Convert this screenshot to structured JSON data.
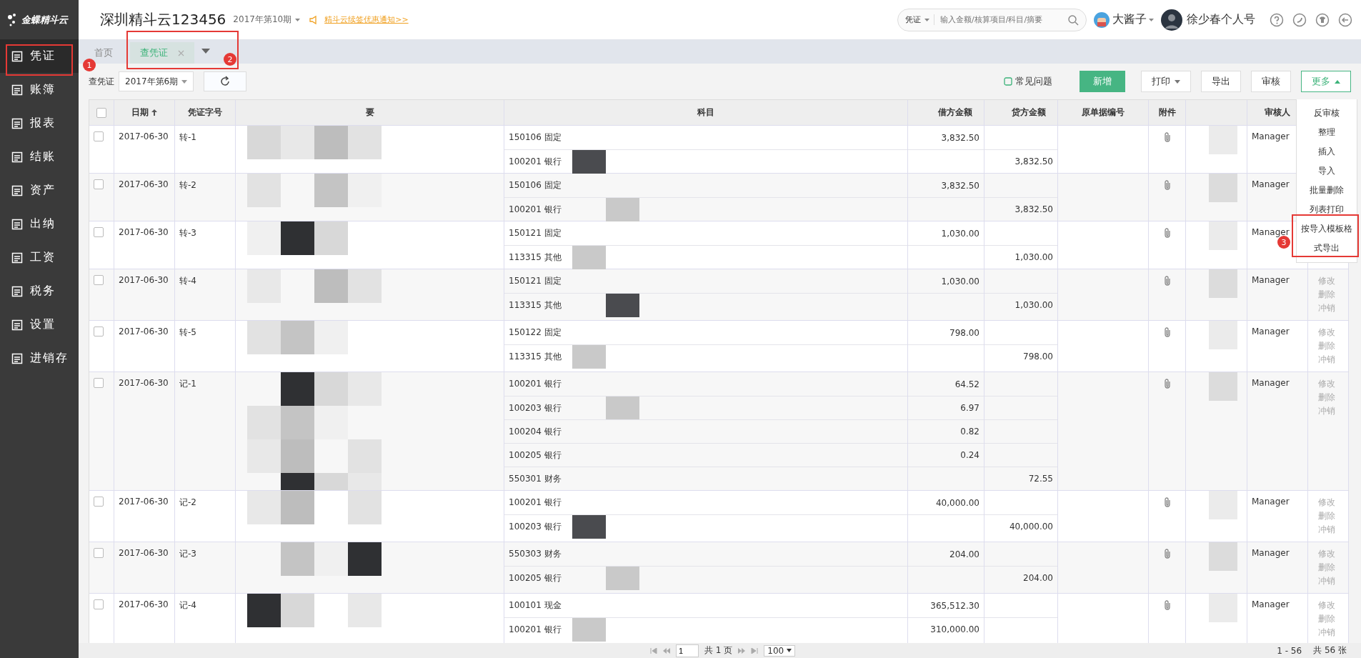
{
  "logo": {
    "text": "金蝶精斗云"
  },
  "sidebar": {
    "items": [
      {
        "label": "凭证",
        "selected": true
      },
      {
        "label": "账簿",
        "selected": false
      },
      {
        "label": "报表",
        "selected": false
      },
      {
        "label": "结账",
        "selected": false
      },
      {
        "label": "资产",
        "selected": false
      },
      {
        "label": "出纳",
        "selected": false
      },
      {
        "label": "工资",
        "selected": false
      },
      {
        "label": "税务",
        "selected": false
      },
      {
        "label": "设置",
        "selected": false
      },
      {
        "label": "进销存",
        "selected": false
      }
    ]
  },
  "header": {
    "company": "深圳精斗云123456",
    "period": "2017年第10期",
    "notice": "精斗云续签优惠通知>>",
    "search_scope": "凭证",
    "search": {
      "placeholder": "输入金额/核算项目/科目/摘要"
    },
    "account": "大酱子",
    "user": "徐少春个人号"
  },
  "tabs": [
    {
      "label": "首页",
      "selected": false,
      "closable": false
    },
    {
      "label": "查凭证",
      "selected": true,
      "closable": true
    }
  ],
  "toolbar": {
    "label": "查凭证",
    "period": "2017年第6期",
    "help": "常见问题",
    "buttons": [
      {
        "label": "新增",
        "kind": "primary"
      },
      {
        "label": "打印",
        "kind": "dropdown"
      },
      {
        "label": "导出",
        "kind": "plain"
      },
      {
        "label": "审核",
        "kind": "plain"
      },
      {
        "label": "更多",
        "kind": "open"
      }
    ]
  },
  "more_menu": [
    "反审核",
    "整理",
    "插入",
    "导入",
    "批量删除",
    "列表打印",
    "按导入模板格",
    "式导出"
  ],
  "table": {
    "select_all": {
      "checked": false
    },
    "columns": [
      "日期",
      "凭证字号",
      "要",
      "科目",
      "借方金额",
      "贷方金额",
      "原单据编号",
      "附件",
      "审核人"
    ],
    "rows": [
      {
        "checked": false,
        "date": "2017-06-30",
        "number": "转-1",
        "attachment": true,
        "reviewer": "Manager",
        "lines": [
          {
            "account": "150106 固定",
            "debit": "3,832.50"
          },
          {
            "account": "100201 银行",
            "credit": "3,832.50"
          }
        ]
      },
      {
        "checked": false,
        "date": "2017-06-30",
        "number": "转-2",
        "attachment": true,
        "reviewer": "Manager",
        "lines": [
          {
            "account": "150106 固定",
            "debit": "3,832.50"
          },
          {
            "account": "100201 银行",
            "credit": "3,832.50"
          }
        ]
      },
      {
        "checked": false,
        "date": "2017-06-30",
        "number": "转-3",
        "attachment": true,
        "reviewer": "Manager",
        "lines": [
          {
            "account": "150121 固定",
            "debit": "1,030.00"
          },
          {
            "account": "113315 其他",
            "credit": "1,030.00"
          }
        ]
      },
      {
        "checked": false,
        "date": "2017-06-30",
        "number": "转-4",
        "attachment": true,
        "reviewer": "Manager",
        "actions": [
          "修改",
          "删除",
          "冲销"
        ],
        "lines": [
          {
            "account": "150121 固定",
            "debit": "1,030.00"
          },
          {
            "account": "113315 其他",
            "credit": "1,030.00"
          }
        ]
      },
      {
        "checked": false,
        "date": "2017-06-30",
        "number": "转-5",
        "attachment": true,
        "reviewer": "Manager",
        "actions": [
          "修改",
          "删除",
          "冲销"
        ],
        "lines": [
          {
            "account": "150122 固定",
            "debit": "798.00"
          },
          {
            "account": "113315 其他",
            "credit": "798.00"
          }
        ]
      },
      {
        "checked": false,
        "date": "2017-06-30",
        "number": "记-1",
        "attachment": true,
        "reviewer": "Manager",
        "actions": [
          "修改",
          "删除",
          "冲销"
        ],
        "lines": [
          {
            "account": "100201 银行",
            "debit": "64.52"
          },
          {
            "account": "100203 银行",
            "debit": "6.97"
          },
          {
            "account": "100204 银行",
            "debit": "0.82"
          },
          {
            "account": "100205 银行",
            "debit": "0.24"
          },
          {
            "account": "550301 财务",
            "credit": "72.55"
          }
        ]
      },
      {
        "checked": false,
        "date": "2017-06-30",
        "number": "记-2",
        "attachment": true,
        "reviewer": "Manager",
        "actions": [
          "修改",
          "删除",
          "冲销"
        ],
        "lines": [
          {
            "account": "100201 银行",
            "debit": "40,000.00"
          },
          {
            "account": "100203 银行",
            "credit": "40,000.00"
          }
        ]
      },
      {
        "checked": false,
        "date": "2017-06-30",
        "number": "记-3",
        "attachment": true,
        "reviewer": "Manager",
        "actions": [
          "修改",
          "删除",
          "冲销"
        ],
        "lines": [
          {
            "account": "550303 财务",
            "debit": "204.00"
          },
          {
            "account": "100205 银行",
            "credit": "204.00"
          }
        ]
      },
      {
        "checked": false,
        "date": "2017-06-30",
        "number": "记-4",
        "attachment": true,
        "reviewer": "Manager",
        "actions": [
          "修改",
          "删除",
          "冲销"
        ],
        "lines": [
          {
            "account": "100101 现金",
            "debit": "365,512.30"
          },
          {
            "account": "100201 银行",
            "debit": "310,000.00"
          }
        ]
      }
    ]
  },
  "pagination": {
    "page": "1",
    "pages": "共 1 页",
    "page_size": "100",
    "range": "1 - 56",
    "total": "共 56 张"
  },
  "annotations": [
    "1",
    "2",
    "3"
  ]
}
